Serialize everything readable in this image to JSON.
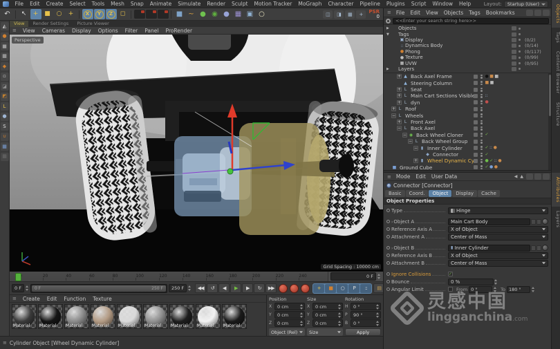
{
  "icons": {
    "hamburger": "≡",
    "caret_left": "◀",
    "caret_up": "▲"
  },
  "menubar": {
    "items": [
      "File",
      "Edit",
      "Create",
      "Select",
      "Tools",
      "Mesh",
      "Snap",
      "Animate",
      "Simulate",
      "Render",
      "Sculpt",
      "Motion Tracker",
      "MoGraph",
      "Character",
      "Pipeline",
      "Plugins",
      "Script",
      "Window",
      "Help"
    ],
    "layout_label": "Layout:",
    "layout_value": "Startup (User)"
  },
  "toolbar": {
    "undo_glyph": "↶",
    "tools": [
      {
        "n": "live-selection-icon",
        "g": "↖",
        "c": "#e2e2e2"
      },
      {
        "n": "move-tool-icon",
        "g": "+",
        "c": "#e7c24a",
        "active": true
      },
      {
        "n": "scale-tool-icon",
        "g": "■",
        "c": "#e7c24a"
      },
      {
        "n": "rotate-tool-icon",
        "g": "○",
        "c": "#e7c24a"
      },
      {
        "n": "last-tool-icon",
        "g": "+",
        "c": "#e7c24a"
      }
    ],
    "axis_locks": [
      {
        "n": "x-axis-lock",
        "g": "X"
      },
      {
        "n": "y-axis-lock",
        "g": "Y"
      },
      {
        "n": "z-axis-lock",
        "g": "Z"
      }
    ],
    "coord_icon": {
      "n": "coordinate-system-icon",
      "g": "◻",
      "c": "#e7c24a"
    },
    "render_icons": [
      {
        "n": "render-view-icon",
        "rev": false
      },
      {
        "n": "render-picture-viewer-icon",
        "rev": true
      },
      {
        "n": "render-settings-icon",
        "rev": true
      }
    ],
    "create_icons": [
      {
        "n": "primitive-cube-icon",
        "g": "■",
        "c": "#7fa3c8"
      },
      {
        "n": "spline-pen-icon",
        "g": "~",
        "c": "#d8a040"
      },
      {
        "n": "generators-icon",
        "g": "●",
        "c": "#6fc14f"
      },
      {
        "n": "deformers-icon",
        "g": "◉",
        "c": "#5fae3f"
      },
      {
        "n": "volume-icon",
        "g": "●",
        "c": "#97a3d6"
      },
      {
        "n": "environment-icon",
        "g": "▦",
        "c": "#9a8fd0"
      },
      {
        "n": "camera-icon",
        "g": "▣",
        "c": "#8fb0d0"
      },
      {
        "n": "light-icon",
        "g": "○",
        "c": "#e8e3c0"
      }
    ],
    "right_icons": [
      {
        "n": "viewport-solo-icon",
        "g": "◫"
      },
      {
        "n": "viewport-layers-icon",
        "g": "◨"
      },
      {
        "n": "snap-settings-icon",
        "g": "▦"
      },
      {
        "n": "workplane-icon",
        "g": "+"
      }
    ],
    "psr_label": "PSR",
    "psr_value": "0"
  },
  "left_toolbar": [
    {
      "n": "make-editable-icon",
      "g": "◭",
      "c": "#cfcfcf"
    },
    {
      "n": "model-mode-icon",
      "g": "●",
      "c": "#d08030"
    },
    {
      "n": "object-mode-icon",
      "g": "■",
      "c": "#9a9a9a"
    },
    {
      "n": "texture-mode-icon",
      "g": "▦",
      "c": "#bdbdbd"
    },
    {
      "n": "workplane-mode-icon",
      "g": "◆",
      "c": "#d08030"
    },
    {
      "n": "points-mode-icon",
      "g": "▫",
      "c": "#cfcfcf"
    },
    {
      "n": "edges-mode-icon",
      "g": "◪",
      "c": "#8f8f8f"
    },
    {
      "n": "polygons-mode-icon",
      "g": "◩",
      "c": "#c08030"
    },
    {
      "n": "axis-mode-icon",
      "g": "L",
      "c": "#e7c24a"
    },
    {
      "n": "tweak-mode-icon",
      "g": "●",
      "c": "#9fb6d4"
    },
    {
      "n": "snap-toggle-icon",
      "g": "S",
      "c": "#e0e0e0"
    },
    {
      "n": "magnet-icon",
      "g": "∪",
      "c": "#d08030"
    },
    {
      "n": "workplane-grid-icon",
      "g": "▦",
      "c": "#7a9fd4"
    },
    {
      "n": "quantize-icon",
      "g": "▦",
      "c": "#6a6a6a"
    }
  ],
  "viewport": {
    "tabs": [
      {
        "label": "View",
        "active": true
      },
      {
        "label": "Render Settings",
        "active": false
      },
      {
        "label": "Picture Viewer",
        "active": false
      }
    ],
    "menu": [
      "View",
      "Cameras",
      "Display",
      "Options",
      "Filter",
      "Panel",
      "ProRender"
    ],
    "camera_label": "Perspective",
    "grid_label": "Grid Spacing : 10000 cm"
  },
  "timeline": {
    "ticks": [
      "0",
      "20",
      "40",
      "60",
      "80",
      "100",
      "120",
      "140",
      "160",
      "180",
      "200",
      "220",
      "240"
    ],
    "current": "0 F"
  },
  "transport": {
    "frame": "0 F",
    "range_left": "0 F",
    "range_right": "250 F",
    "end": "250 F",
    "buttons": [
      {
        "n": "goto-start-button",
        "g": "◀◀"
      },
      {
        "n": "play-backwards-button",
        "g": "↺"
      },
      {
        "n": "previous-frame-button",
        "g": "◀"
      },
      {
        "n": "play-button",
        "g": "▶",
        "c": "#74c043"
      },
      {
        "n": "next-frame-button",
        "g": "▶"
      },
      {
        "n": "loop-button",
        "g": "↻"
      },
      {
        "n": "goto-end-button",
        "g": "▶▶"
      }
    ],
    "key_toggles": [
      {
        "n": "key-position-toggle",
        "g": "+",
        "c": "#e7c24a"
      },
      {
        "n": "key-scale-toggle",
        "g": "■",
        "c": "#d08030"
      },
      {
        "n": "key-rotation-toggle",
        "g": "○",
        "c": "#e0e0e0"
      },
      {
        "n": "key-parameter-toggle",
        "g": "P",
        "c": "#e0e0e0"
      },
      {
        "n": "key-pla-toggle",
        "g": "::",
        "c": "#e0e0e0"
      }
    ]
  },
  "materials": {
    "menu": [
      "Create",
      "Edit",
      "Function",
      "Texture"
    ],
    "items": [
      {
        "label": "Material",
        "color": "#3a3a3a"
      },
      {
        "label": "Material",
        "color": "#151515"
      },
      {
        "label": "Material",
        "color": "#8a8a8a"
      },
      {
        "label": "Material",
        "color": "#b29a83"
      },
      {
        "label": "Material",
        "color": "#d9d9d9"
      },
      {
        "label": "Material",
        "color": "#8f8f8f"
      },
      {
        "label": "Material",
        "color": "#1e1e1e"
      },
      {
        "label": "Material",
        "color": "#f2f2f2"
      },
      {
        "label": "Material",
        "color": "#1a1a1a"
      }
    ]
  },
  "coordinates": {
    "groups": [
      {
        "title": "Position",
        "footer": "Object (Rel)",
        "footer_kind": "dropdown",
        "rows": [
          {
            "k": "X",
            "v": "0 cm"
          },
          {
            "k": "Y",
            "v": "0 cm"
          },
          {
            "k": "Z",
            "v": "0 cm"
          }
        ]
      },
      {
        "title": "Size",
        "footer": "Size",
        "footer_kind": "dropdown",
        "rows": [
          {
            "k": "X",
            "v": "0 cm"
          },
          {
            "k": "Y",
            "v": "0 cm"
          },
          {
            "k": "Z",
            "v": "0 cm"
          }
        ]
      },
      {
        "title": "Rotation",
        "footer": "Apply",
        "footer_kind": "button",
        "rows": [
          {
            "k": "H",
            "v": "0 °"
          },
          {
            "k": "P",
            "v": "90 °"
          },
          {
            "k": "B",
            "v": "0 °"
          }
        ]
      }
    ]
  },
  "statusbar": {
    "text": "Cylinder Object [Wheel Dynamic Cylinder]"
  },
  "object_manager": {
    "menu": [
      "File",
      "Edit",
      "View",
      "Objects",
      "Tags",
      "Bookmarks"
    ],
    "search_placeholder": "<<Enter your search string here>>",
    "filters": [
      {
        "label": "Objects",
        "indent": 0,
        "exp": "▶",
        "g": "",
        "c": "",
        "count": ""
      },
      {
        "label": "Tags",
        "indent": 0,
        "exp": "▼",
        "g": "",
        "c": "",
        "count": ""
      },
      {
        "label": "Display",
        "indent": 1,
        "exp": "",
        "g": "▣",
        "c": "#9fb6d4",
        "count": "(0/2)"
      },
      {
        "label": "Dynamics Body",
        "indent": 1,
        "exp": "",
        "g": "::",
        "c": "#9fb6d4",
        "count": "(0/14)"
      },
      {
        "label": "Phong",
        "indent": 1,
        "exp": "",
        "g": "●",
        "c": "#d08030",
        "count": "(0/117)"
      },
      {
        "label": "Texture",
        "indent": 1,
        "exp": "",
        "g": "●",
        "c": "#bfbfbf",
        "count": "(0/99)"
      },
      {
        "label": "UVW",
        "indent": 1,
        "exp": "",
        "g": "▦",
        "c": "#d8d8d8",
        "count": "(0/95)"
      },
      {
        "label": "Layers",
        "indent": 0,
        "exp": "▶",
        "g": "",
        "c": "",
        "count": ""
      }
    ],
    "tree": [
      {
        "name": "Back Axel Frame",
        "indent": 2,
        "exp": "+",
        "icon": {
          "g": "▲",
          "c": "#8fb3d9"
        },
        "tags": [
          {
            "g": "●",
            "c": "#101010"
          },
          {
            "g": "■",
            "c": "#c98a4b"
          },
          {
            "g": "▦",
            "c": "#e8e8e8"
          }
        ]
      },
      {
        "name": "Steering Column",
        "indent": 2,
        "exp": "",
        "icon": {
          "g": "▲",
          "c": "#8fb3d9"
        },
        "tags": [
          {
            "g": "■",
            "c": "#c98a4b"
          },
          {
            "g": "▦",
            "c": "#e8e8e8"
          }
        ]
      },
      {
        "name": "Seat",
        "indent": 2,
        "exp": "+",
        "icon": {
          "g": "L",
          "c": "#a8bdd0"
        },
        "tags": []
      },
      {
        "name": "Main Cart Sections Visible",
        "indent": 2,
        "exp": "+",
        "icon": {
          "g": "L",
          "c": "#a8bdd0"
        },
        "tags": [
          {
            "g": "::",
            "c": "#9fb6d4"
          }
        ]
      },
      {
        "name": "dyn",
        "indent": 2,
        "exp": "+",
        "icon": {
          "g": "L",
          "c": "#a8bdd0"
        },
        "tags": [
          {
            "g": "●",
            "c": "#c0504d"
          }
        ]
      },
      {
        "name": "Roof",
        "indent": 1,
        "exp": "+",
        "icon": {
          "g": "L",
          "c": "#a8bdd0"
        },
        "tags": []
      },
      {
        "name": "Wheels",
        "indent": 1,
        "exp": "−",
        "icon": {
          "g": "L",
          "c": "#a8bdd0"
        },
        "tags": []
      },
      {
        "name": "Front Axel",
        "indent": 2,
        "exp": "+",
        "icon": {
          "g": "L",
          "c": "#a8bdd0"
        },
        "tags": []
      },
      {
        "name": "Back Axel",
        "indent": 2,
        "exp": "−",
        "icon": {
          "g": "L",
          "c": "#a8bdd0"
        },
        "tags": []
      },
      {
        "name": "Back Wheel Cloner",
        "indent": 3,
        "exp": "−",
        "icon": {
          "g": "◉",
          "c": "#6fc14f"
        },
        "tags": [
          {
            "g": "✓",
            "c": "#7ec14f"
          }
        ]
      },
      {
        "name": "Back Wheel Group",
        "indent": 4,
        "exp": "−",
        "icon": {
          "g": "L",
          "c": "#a8bdd0"
        },
        "tags": []
      },
      {
        "name": "Inner Cylinder",
        "indent": 5,
        "exp": "−",
        "icon": {
          "g": "▮",
          "c": "#8fa8c8"
        },
        "tags": [
          {
            "g": "✓",
            "c": "#7ec14f"
          },
          {
            "g": "::",
            "c": "#9fb6d4"
          },
          {
            "g": "●",
            "c": "#c98a4b"
          }
        ]
      },
      {
        "name": "Connector",
        "indent": 6,
        "exp": "",
        "icon": {
          "g": "◆",
          "c": "#8fa8c8"
        },
        "tags": [
          {
            "g": "✓",
            "c": "#7ec14f"
          }
        ]
      },
      {
        "name": "Wheel Dynamic Cylinder",
        "indent": 5,
        "exp": "+",
        "selected": true,
        "icon": {
          "g": "▮",
          "c": "#8fa8c8"
        },
        "tags": [
          {
            "g": "●",
            "c": "#6fbf4a"
          },
          {
            "g": "✓",
            "c": "#7ec14f"
          },
          {
            "g": "::",
            "c": "#9fb6d4"
          },
          {
            "g": "●",
            "c": "#c98a4b"
          }
        ]
      },
      {
        "name": "Ground Cube",
        "indent": 0,
        "exp": "",
        "icon": {
          "g": "■",
          "c": "#7a9fd4"
        },
        "tags": [
          {
            "g": "✓",
            "c": "#7ec14f"
          },
          {
            "g": "●",
            "c": "#7a9fd4"
          },
          {
            "g": "●",
            "c": "#c98a4b"
          }
        ]
      }
    ]
  },
  "attributes": {
    "menu": [
      "Mode",
      "Edit",
      "User Data"
    ],
    "title": "Connector [Connector]",
    "tabs": [
      {
        "label": "Basic"
      },
      {
        "label": "Coord."
      },
      {
        "label": "Object",
        "active": true
      },
      {
        "label": "Display"
      },
      {
        "label": "Cache"
      }
    ],
    "section": "Object Properties",
    "rows": [
      {
        "kind": "dropdown",
        "label": "Type",
        "value": "Hinge",
        "lead_icon": true
      },
      {
        "kind": "link",
        "label": "Object A",
        "value": "Main Cart Body",
        "gap": true,
        "exp": "›",
        "obj_icon": ""
      },
      {
        "kind": "dropdown",
        "label": "Reference Axis A",
        "value": "X of Object"
      },
      {
        "kind": "dropdown",
        "label": "Attachment A",
        "value": "Center of Mass"
      },
      {
        "kind": "link",
        "label": "Object B",
        "value": "Inner Cylinder",
        "gap": true,
        "exp": "›",
        "obj_icon": "▮"
      },
      {
        "kind": "dropdown",
        "label": "Reference Axis B",
        "value": "X of Object"
      },
      {
        "kind": "dropdown",
        "label": "Attachment B",
        "value": "Center of Mass"
      },
      {
        "kind": "check",
        "label": "Ignore Collisions",
        "value": "✓",
        "hl": true,
        "gap": true
      },
      {
        "kind": "field",
        "label": "Bounce",
        "value": "0 %"
      },
      {
        "kind": "limit",
        "label": "Angular Limit",
        "from_label": "From",
        "from_value": "0 °",
        "to_label": "To",
        "to_value": "180 °"
      }
    ]
  },
  "right_tabs": {
    "top": [
      {
        "label": "Objects",
        "active": true
      },
      {
        "label": "Tags"
      },
      {
        "label": "Content Browser"
      },
      {
        "label": "Structure"
      }
    ],
    "bottom": [
      {
        "label": "Attributes",
        "active": true
      },
      {
        "label": "Layers"
      }
    ]
  },
  "watermark": {
    "cn": "灵感中国",
    "en": "lingganchina",
    "tld": ".com"
  }
}
